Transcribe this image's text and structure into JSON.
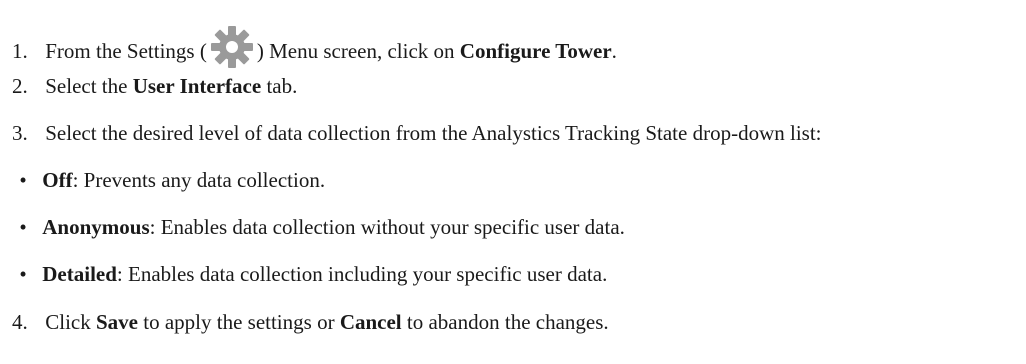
{
  "steps": [
    {
      "num": "1.",
      "pre": "From the Settings (",
      "icon": "gear-icon",
      "mid": ") Menu screen, click on ",
      "bold": "Configure Tower",
      "post": "."
    },
    {
      "num": "2.",
      "pre": "Select the ",
      "bold": "User Interface",
      "post": " tab."
    },
    {
      "num": "3.",
      "text": "Select the desired level of data collection from the Analystics Tracking State drop-down list:"
    },
    {
      "num": "4.",
      "pre": "Click ",
      "bold1": "Save",
      "mid": " to apply the settings or ",
      "bold2": "Cancel",
      "post": " to abandon the changes."
    }
  ],
  "options": [
    {
      "bullet": "•",
      "bold": "Off",
      "text": ": Prevents any data collection."
    },
    {
      "bullet": "•",
      "bold": "Anonymous",
      "text": ": Enables data collection without your specific user data."
    },
    {
      "bullet": "•",
      "bold": "Detailed",
      "text": ": Enables data collection including your specific user data."
    }
  ],
  "colors": {
    "text": "#1a1a1a",
    "gear": "#9a9a9a"
  }
}
